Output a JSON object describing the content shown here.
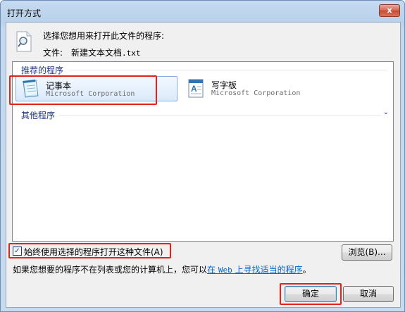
{
  "window": {
    "title": "打开方式",
    "close_label": "x"
  },
  "header": {
    "prompt": "选择您想用来打开此文件的程序:",
    "file_label": "文件:",
    "file_name": "新建文本文档",
    "file_ext": ".txt"
  },
  "list": {
    "recommended_header": "推荐的程序",
    "programs": [
      {
        "name": "记事本",
        "publisher": "Microsoft Corporation",
        "icon": "notepad-icon",
        "selected": true
      },
      {
        "name": "写字板",
        "publisher": "Microsoft Corporation",
        "icon": "wordpad-icon",
        "selected": false
      }
    ],
    "other_header": "其他程序",
    "expand_glyph": "⌄"
  },
  "options": {
    "always_use_label": "始终使用选择的程序打开这种文件(A)",
    "always_use_checked": true,
    "browse_label": "浏览(B)..."
  },
  "info": {
    "text_prefix": "如果您想要的程序不在列表或您的计算机上，您可以",
    "link_pre": "在",
    "link_web": "Web",
    "link_post": "上寻找适当的程序",
    "suffix": "。"
  },
  "buttons": {
    "ok": "确定",
    "cancel": "取消"
  },
  "colors": {
    "highlight_red": "#e8201a",
    "link": "#0066cc",
    "group_header": "#1e3287"
  }
}
